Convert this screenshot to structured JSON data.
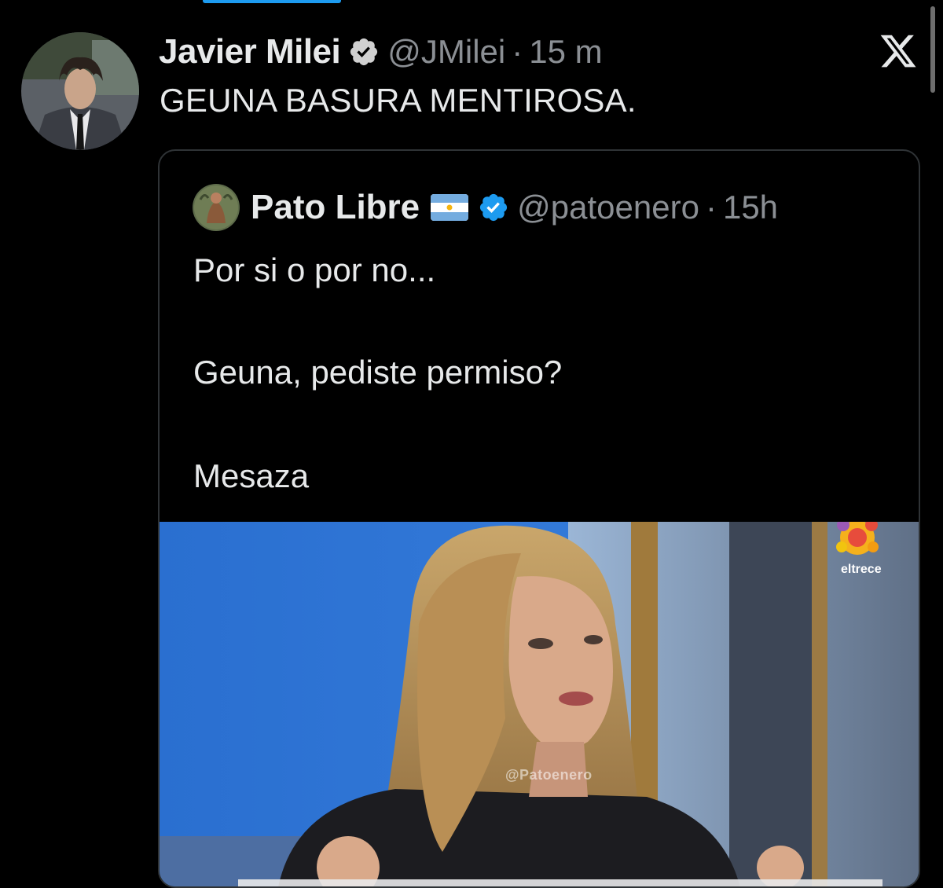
{
  "main_tweet": {
    "author_name": "Javier Milei",
    "handle": "@JMilei",
    "separator": "·",
    "time": "15 m",
    "text": "GEUNA BASURA MENTIROSA."
  },
  "quoted_tweet": {
    "author_name": "Pato Libre",
    "handle": "@patoenero",
    "separator": "·",
    "time": "15h",
    "lines": [
      "Por si o por no...",
      "Geuna, pediste permiso?",
      "Mesaza"
    ],
    "media": {
      "watermark": "@Patoenero",
      "channel_label": "eltrece"
    }
  },
  "icons": {
    "verified": "verified-badge-icon",
    "close": "x-logo-icon",
    "flag": "argentina-flag-icon"
  },
  "colors": {
    "background": "#000000",
    "accent": "#1d9bf0",
    "text_primary": "#e7e9ea",
    "text_secondary": "#8b8f94",
    "border": "#2f3336"
  }
}
